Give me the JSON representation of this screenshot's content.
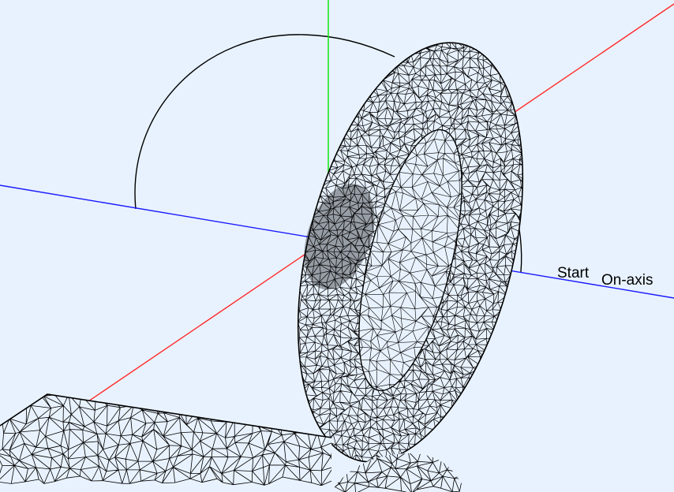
{
  "viewport": {
    "background": "#e8f2fe",
    "labels": {
      "start": "Start",
      "on_axis": "On-axis"
    }
  },
  "axes": {
    "x_color": "#ff2a2a",
    "y_color": "#1ee81e",
    "z_color": "#1a1aff"
  },
  "objects": {
    "mesh_color": "#000000",
    "path_color": "#000000"
  }
}
